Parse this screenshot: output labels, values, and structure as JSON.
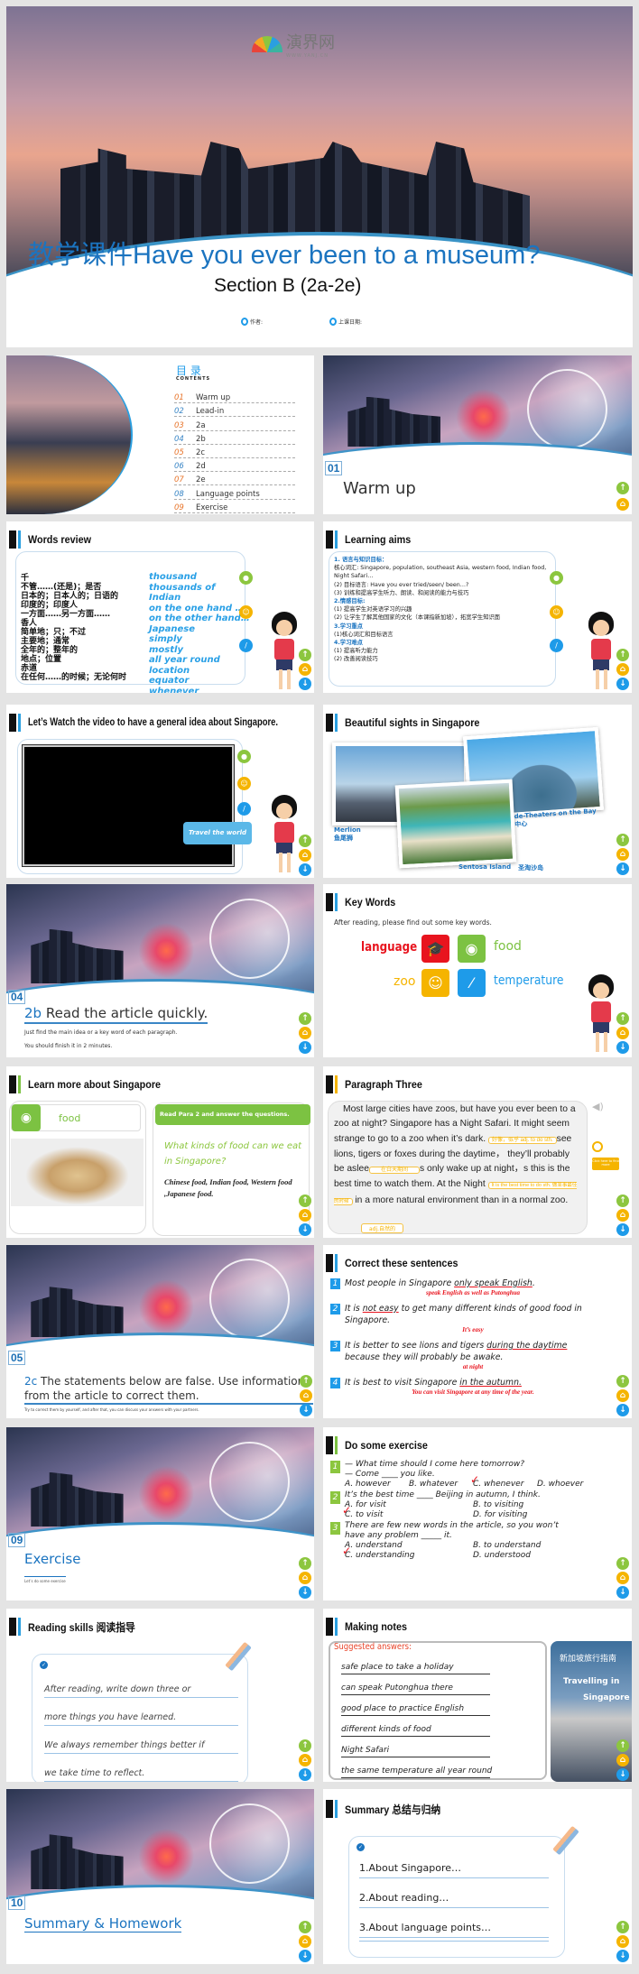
{
  "title_slide": {
    "logo_text": "演界网",
    "logo_url": "WWW.YANJ.CN",
    "title": "教学课件Have you ever been to a museum?",
    "subtitle": "Section B (2a-2e)",
    "author_label": "作者:",
    "date_label": "上课日期:"
  },
  "contents": {
    "heading": "目 录",
    "sub": "CONTENTS",
    "items": [
      {
        "num": "01",
        "label": "Warm up"
      },
      {
        "num": "02",
        "label": "Lead-in"
      },
      {
        "num": "03",
        "label": "2a"
      },
      {
        "num": "04",
        "label": "2b"
      },
      {
        "num": "05",
        "label": "2c"
      },
      {
        "num": "06",
        "label": "2d"
      },
      {
        "num": "07",
        "label": "2e"
      },
      {
        "num": "08",
        "label": "Language points"
      },
      {
        "num": "09",
        "label": "Exercise"
      }
    ]
  },
  "warmup": {
    "num": "01",
    "title": "Warm up"
  },
  "words_review": {
    "title": "Words review",
    "chinese": [
      "千",
      "不管……(还是)；是否",
      "日本的；日本人的；日语的",
      "印度的；印度人",
      "一方面……另一方面……",
      "香人",
      "简单地；只；不过",
      "主要地；通常",
      "全年的；整年的",
      "地点；位置",
      "赤道",
      "在任何……的时候；无论何时"
    ],
    "english": [
      "thousand",
      "thousands of",
      "Indian",
      "on the one hand …",
      "on the other hand…",
      "Japanese",
      "simply",
      "mostly",
      "all year round",
      "location",
      "equator",
      "whenever"
    ]
  },
  "learning_aims": {
    "title": "Learning aims",
    "lines": [
      {
        "text": "1. 语言与知识目标：",
        "head": true
      },
      {
        "text": "核心词汇: Singapore, population, southeast Asia, western food, Indian food, Night Safari…"
      },
      {
        "text": "(2) 目标语言: Have you ever tried/seen/ been…?"
      },
      {
        "text": "(3) 训练和提高学生听力、朗读、和阅读的能力与技巧"
      },
      {
        "text": "2.情感目标:",
        "head": true
      },
      {
        "text": "(1) 提高学生对英语学习的兴趣"
      },
      {
        "text": "(2) 让学生了解其他国家的文化（本课指新加坡），拓宽学生知识面"
      },
      {
        "text": "3.学习重点",
        "head": true
      },
      {
        "text": "(1)核心词汇和目标语言"
      },
      {
        "text": "4.学习难点",
        "head": true
      },
      {
        "text": "(1) 提高听力能力"
      },
      {
        "text": "(2) 改善阅读技巧"
      }
    ]
  },
  "video": {
    "title": "Let’s Watch the video to have a general idea about  Singapore.",
    "button": "Travel the world"
  },
  "sights": {
    "title": "Beautiful sights in Singapore",
    "merlion_en": "Merlion",
    "merlion_cn": "鱼尾狮",
    "esplanade_en": "de-Theaters on the Bay",
    "esplanade_cn": "中心",
    "sentosa_en": "Sentosa Island",
    "sentosa_cn": "圣淘沙岛"
  },
  "read_2b": {
    "num": "04",
    "tag": "2b",
    "title": " Read the article quickly.",
    "line1": "Just find the main idea or a key word of each paragraph.",
    "line2": "You should finish it in 2 minutes."
  },
  "key_words": {
    "title": "Key Words",
    "subtitle": "After reading, please find out some key words.",
    "language": "language",
    "food": "food",
    "zoo": "zoo",
    "temperature": "temperature",
    "colors": {
      "language": "#e8141e",
      "food": "#7cc242",
      "zoo": "#f5b400",
      "temperature": "#1e9be9"
    }
  },
  "learn_more": {
    "title": "Learn more about Singapore",
    "food_label": "food",
    "banner": "Read Para 2  and answer the questions.",
    "question": "What kinds of food can we eat in Singapore?",
    "answer": "Chinese food, Indian food, Western food ,Japanese food."
  },
  "para_three": {
    "title": "Paragraph Three",
    "t1": "Most large cities have zoos, but have you ever been to a zoo at night? Singapore has a Night Safari. It might seem strange to go to a zoo when it’s dark.",
    "a1": "好像，似乎 adj. to do sth.",
    "t2": "see lions, tigers or foxes during the daytime， they’ll probably be aslee",
    "a2": "在白天期间",
    "t3": "s only wake up at night，s this is the best time to watch them. At the Night",
    "a3": "It is the best time to do sth. 做某事最佳的时候",
    "t4": "in a more natural environment than in a normal zoo.",
    "a4": "adj.自然的",
    "find_more": "Click here to find more"
  },
  "read_2c": {
    "num": "05",
    "tag": "2c",
    "title": " The statements below are false. Use information from the article to correct them.",
    "note": "Try to correct them by yourself, and after that, you can discuss your answers with your partners."
  },
  "correct": {
    "title": "Correct these sentences",
    "items": [
      {
        "n": "1",
        "pre": "Most people in Singapore ",
        "u": "only speak English",
        "post": ".",
        "fix": "speak English as well as Putonghua"
      },
      {
        "n": "2",
        "pre": "It is ",
        "u": "not easy",
        "post": " to get many different kinds of good food in Singapore.",
        "fix": "It’s easy"
      },
      {
        "n": "3",
        "pre": "It is better to see lions and tigers ",
        "u": "during the daytime",
        "post": " because they will probably be awake.",
        "fix": "at night"
      },
      {
        "n": "4",
        "pre": "It is best to visit Singapore ",
        "u": "in the autumn.",
        "post": "",
        "fix": "You can visit Singapore at any time of the year."
      }
    ]
  },
  "exercise_section": {
    "num": "09",
    "title": "Exercise",
    "sub": "Let’s do some exercise"
  },
  "do_exercise": {
    "title": "Do some exercise",
    "q": [
      {
        "n": "1",
        "lines": [
          "— What time should I come here tomorrow?",
          "— Come ____ you like."
        ],
        "opts": [
          "A. however",
          "B. whatever",
          "C. whenever",
          "D. whoever"
        ],
        "answer": "C"
      },
      {
        "n": "2",
        "lines": [
          "It’s the best time ____ Beijing in autumn, I think."
        ],
        "opts": [
          "A. for visit",
          "B. to visiting",
          "C. to visit",
          "D. for visiting"
        ],
        "answer": "C"
      },
      {
        "n": "3",
        "lines": [
          "There are few new words in the article, so you won’t",
          "have any problem _____ it."
        ],
        "opts": [
          "A. understand",
          "B. to understand",
          "C. understanding",
          "D. understood"
        ],
        "answer": "C"
      }
    ]
  },
  "reading_skills": {
    "title": "Reading skills 阅读指导",
    "lines": [
      "After reading, write down three or",
      "more things you have learned.",
      "We always remember things better if",
      "we take time to reflect."
    ]
  },
  "making_notes": {
    "title": "Making notes",
    "suggested": "Suggested answers:",
    "lines": [
      "safe place to take a holiday",
      "can speak Putonghua there",
      "good place to practice English",
      "different kinds of food",
      "Night Safari",
      "the same temperature all year round"
    ],
    "guide_cn": "新加坡旅行指南",
    "guide_en1": "Travelling in",
    "guide_en2": "Singapore"
  },
  "summary_section": {
    "num": "10",
    "title": "Summary & Homework"
  },
  "summary": {
    "title": "Summary 总结与归纳",
    "items": [
      "1.About Singapore…",
      "2.About reading…",
      "3.About language points…"
    ]
  },
  "nav": {
    "up": "↑",
    "home": "⌂",
    "down": "↓"
  }
}
